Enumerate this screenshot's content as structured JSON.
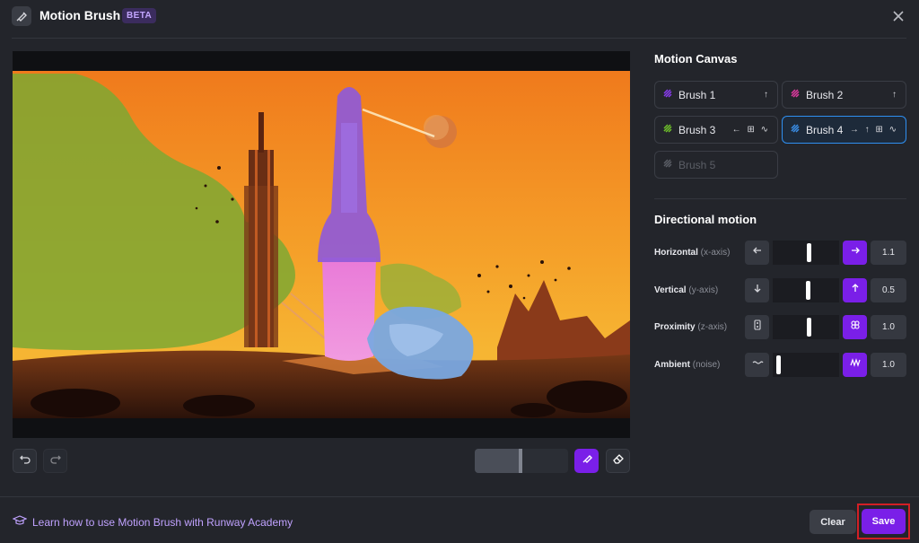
{
  "header": {
    "title": "Motion Brush",
    "badge": "BETA"
  },
  "canvas": {
    "description_icon": "image-canvas"
  },
  "toolbar": {
    "brush_size_fraction": 0.47
  },
  "footer": {
    "academy_link": "Learn how to use Motion Brush with Runway Academy",
    "clear_label": "Clear",
    "save_label": "Save"
  },
  "motion_canvas": {
    "title": "Motion Canvas",
    "brushes": [
      {
        "label": "Brush 1",
        "color": "#8a3cf0",
        "dirs": "↑",
        "active": false
      },
      {
        "label": "Brush 2",
        "color": "#e03aa0",
        "dirs": "↑",
        "active": false
      },
      {
        "label": "Brush 3",
        "color": "#6fc22a",
        "dirs": "← ⊞ ∿",
        "active": false
      },
      {
        "label": "Brush 4",
        "color": "#3a8fe8",
        "dirs": "→ ↑ ⊞ ∿",
        "active": true
      },
      {
        "label": "Brush 5",
        "color": "#5b5e66",
        "dirs": "",
        "active": false
      }
    ]
  },
  "directional_motion": {
    "title": "Directional motion",
    "rows": [
      {
        "label": "Horizontal",
        "sub": "(x-axis)",
        "value": "1.1",
        "level": 0.55
      },
      {
        "label": "Vertical",
        "sub": "(y-axis)",
        "value": "0.5",
        "level": 0.53
      },
      {
        "label": "Proximity",
        "sub": "(z-axis)",
        "value": "1.0",
        "level": 0.55
      },
      {
        "label": "Ambient",
        "sub": "(noise)",
        "value": "1.0",
        "level": 0.06
      }
    ]
  },
  "colors": {
    "accent": "#7a1fe8",
    "active_border": "#2f8ff0",
    "save_highlight": "#d21f25"
  }
}
